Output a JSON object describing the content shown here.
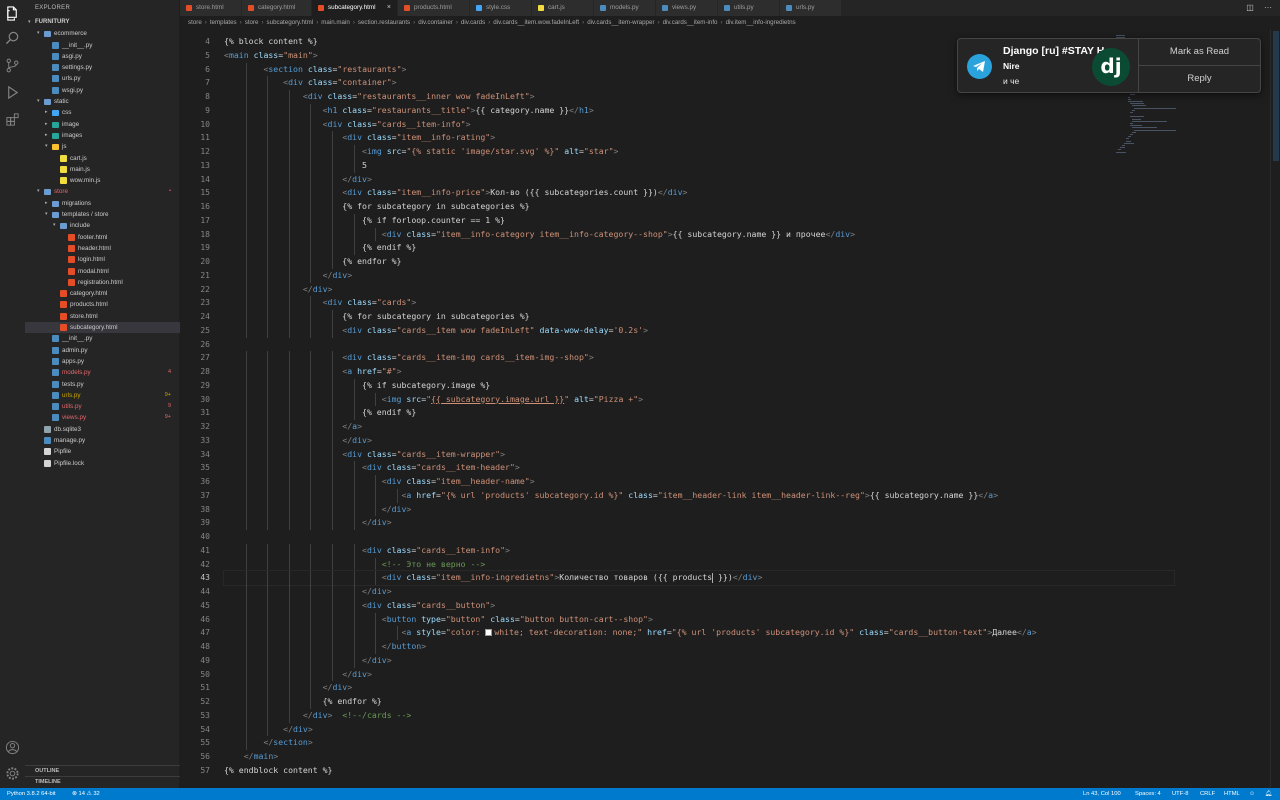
{
  "sidebar": {
    "title": "EXPLORER",
    "root": "FURNITURY",
    "items": [
      {
        "name": "ecommerce",
        "type": "folder",
        "depth": 1,
        "open": true,
        "color": "#6b9bd1"
      },
      {
        "name": "__init__.py",
        "type": "py",
        "depth": 2,
        "color": "#4b8bbe"
      },
      {
        "name": "asgi.py",
        "type": "py",
        "depth": 2,
        "color": "#4b8bbe"
      },
      {
        "name": "settings.py",
        "type": "py",
        "depth": 2,
        "color": "#4b8bbe"
      },
      {
        "name": "urls.py",
        "type": "py",
        "depth": 2,
        "color": "#4b8bbe"
      },
      {
        "name": "wsgi.py",
        "type": "py",
        "depth": 2,
        "color": "#4b8bbe"
      },
      {
        "name": "static",
        "type": "folder",
        "depth": 1,
        "open": true,
        "color": "#6b9bd1"
      },
      {
        "name": "css",
        "type": "folder",
        "depth": 2,
        "open": false,
        "color": "#42a5f5"
      },
      {
        "name": "image",
        "type": "folder",
        "depth": 2,
        "open": false,
        "color": "#26a69a"
      },
      {
        "name": "images",
        "type": "folder",
        "depth": 2,
        "open": false,
        "color": "#26a69a"
      },
      {
        "name": "js",
        "type": "folder",
        "depth": 2,
        "open": true,
        "color": "#fbc02d"
      },
      {
        "name": "cart.js",
        "type": "js",
        "depth": 3,
        "color": "#f1dd3f"
      },
      {
        "name": "main.js",
        "type": "js",
        "depth": 3,
        "color": "#f1dd3f"
      },
      {
        "name": "wow.min.js",
        "type": "js",
        "depth": 3,
        "color": "#f1dd3f"
      },
      {
        "name": "store",
        "type": "folder",
        "depth": 1,
        "open": true,
        "color": "#6b9bd1",
        "modified": true,
        "badge": "•"
      },
      {
        "name": "migrations",
        "type": "folder",
        "depth": 2,
        "open": false,
        "color": "#6b9bd1"
      },
      {
        "name": "templates / store",
        "type": "folder",
        "depth": 2,
        "open": true,
        "color": "#6b9bd1"
      },
      {
        "name": "include",
        "type": "folder",
        "depth": 3,
        "open": true,
        "color": "#6b9bd1"
      },
      {
        "name": "footer.html",
        "type": "html",
        "depth": 4,
        "color": "#e44d26"
      },
      {
        "name": "header.html",
        "type": "html",
        "depth": 4,
        "color": "#e44d26"
      },
      {
        "name": "login.html",
        "type": "html",
        "depth": 4,
        "color": "#e44d26"
      },
      {
        "name": "modal.html",
        "type": "html",
        "depth": 4,
        "color": "#e44d26"
      },
      {
        "name": "registration.html",
        "type": "html",
        "depth": 4,
        "color": "#e44d26"
      },
      {
        "name": "category.html",
        "type": "html",
        "depth": 3,
        "color": "#e44d26"
      },
      {
        "name": "products.html",
        "type": "html",
        "depth": 3,
        "color": "#e44d26"
      },
      {
        "name": "store.html",
        "type": "html",
        "depth": 3,
        "color": "#e44d26"
      },
      {
        "name": "subcategory.html",
        "type": "html",
        "depth": 3,
        "color": "#e44d26",
        "active": true
      },
      {
        "name": "__init__.py",
        "type": "py",
        "depth": 2,
        "color": "#4b8bbe"
      },
      {
        "name": "admin.py",
        "type": "py",
        "depth": 2,
        "color": "#4b8bbe"
      },
      {
        "name": "apps.py",
        "type": "py",
        "depth": 2,
        "color": "#4b8bbe"
      },
      {
        "name": "models.py",
        "type": "py",
        "depth": 2,
        "color": "#4b8bbe",
        "modified": true,
        "badge": "4"
      },
      {
        "name": "tests.py",
        "type": "py",
        "depth": 2,
        "color": "#4b8bbe"
      },
      {
        "name": "urls.py",
        "type": "py",
        "depth": 2,
        "color": "#4b8bbe",
        "warn": true,
        "badge": "9+"
      },
      {
        "name": "utils.py",
        "type": "py",
        "depth": 2,
        "color": "#4b8bbe",
        "modified": true,
        "badge": "9"
      },
      {
        "name": "views.py",
        "type": "py",
        "depth": 2,
        "color": "#4b8bbe",
        "modified": true,
        "badge": "9+"
      },
      {
        "name": "db.sqlite3",
        "type": "db",
        "depth": 1,
        "color": "#90a4ae"
      },
      {
        "name": "manage.py",
        "type": "py",
        "depth": 1,
        "color": "#4b8bbe"
      },
      {
        "name": "Pipfile",
        "type": "file",
        "depth": 1,
        "color": "#d4d4d4"
      },
      {
        "name": "Pipfile.lock",
        "type": "file",
        "depth": 1,
        "color": "#d4d4d4"
      }
    ],
    "outline": "OUTLINE",
    "timeline": "TIMELINE"
  },
  "tabs": [
    {
      "label": "store.html",
      "color": "#e44d26"
    },
    {
      "label": "category.html",
      "color": "#e44d26"
    },
    {
      "label": "subcategory.html",
      "color": "#e44d26",
      "active": true
    },
    {
      "label": "products.html",
      "color": "#e44d26"
    },
    {
      "label": "style.css",
      "color": "#42a5f5"
    },
    {
      "label": "cart.js",
      "color": "#f1dd3f"
    },
    {
      "label": "models.py",
      "color": "#4b8bbe"
    },
    {
      "label": "views.py",
      "color": "#4b8bbe"
    },
    {
      "label": "utils.py",
      "color": "#4b8bbe"
    },
    {
      "label": "urls.py",
      "color": "#4b8bbe"
    }
  ],
  "breadcrumb": [
    "store",
    "templates",
    "store",
    "subcategory.html",
    "main.main",
    "section.restaurants",
    "div.container",
    "div.cards",
    "div.cards__item.wow.fadeInLeft",
    "div.cards__item-wrapper",
    "div.cards__item-info",
    "div.item__info-ingredietns"
  ],
  "editor": {
    "first_line": 4,
    "current_line": 43,
    "lines": [
      "{% block content %}",
      "<main class=\"main\">",
      "        <section class=\"restaurants\">",
      "            <div class=\"container\">",
      "                <div class=\"restaurants__inner wow fadeInLeft\">",
      "                    <h1 class=\"restaurants__title\">{{ category.name }}</h1>",
      "                    <div class=\"cards__item-info\">",
      "                        <div class=\"item__info-rating\">",
      "                            <img src=\"{% static 'image/star.svg' %}\" alt=\"star\">",
      "                            5",
      "                        </div>",
      "                        <div class=\"item__info-price\">Кол-во ({{ subcategories.count }})</div>",
      "                        {% for subcategory in subcategories %}",
      "                            {% if forloop.counter == 1 %}",
      "                                <div class=\"item__info-category item__info-category--shop\">{{ subcategory.name }} и прочее</div>",
      "                            {% endif %}",
      "                        {% endfor %}",
      "                    </div>",
      "                </div>",
      "                    <div class=\"cards\">",
      "                        {% for subcategory in subcategories %}",
      "                        <div class=\"cards__item wow fadeInLeft\" data-wow-delay='0.2s'>",
      "",
      "                        <div class=\"cards__item-img cards__item-img--shop\">",
      "                        <a href=\"#\">",
      "                            {% if subcategory.image %}",
      "                                <img src=\"{{ subcategory.image.url }}\" alt=\"Pizza +\">",
      "                            {% endif %}",
      "                        </a>",
      "                        </div>",
      "                        <div class=\"cards__item-wrapper\">",
      "                            <div class=\"cards__item-header\">",
      "                                <div class=\"item__header-name\">",
      "                                    <a href=\"{% url 'products' subcategory.id %}\" class=\"item__header-link item__header-link--reg\">{{ subcategory.name }}</a>",
      "                                </div>",
      "                            </div>",
      "",
      "                            <div class=\"cards__item-info\">",
      "                                <!-- Это не верно -->",
      "                                <div class=\"item__info-ingredietns\">Количество товаров ({{ products }})</div>",
      "                            </div>",
      "                            <div class=\"cards__button\">",
      "                                <button type=\"button\" class=\"button button-cart--shop\">",
      "                                    <a style=\"color: white; text-decoration: none;\" href=\"{% url 'products' subcategory.id %}\" class=\"cards__button-text\">Далее</a>",
      "                                </button>",
      "                            </div>",
      "                        </div>",
      "                    </div>",
      "                    {% endfor %}",
      "                </div>  <!--/cards -->",
      "            </div>",
      "        </section>",
      "    </main>",
      "{% endblock content %}"
    ]
  },
  "notification": {
    "title": "Django [ru] #STAY H...",
    "sender": "Nire",
    "message": "и че",
    "avatar_text": "dj",
    "actions": [
      "Mark as Read",
      "Reply"
    ]
  },
  "statusbar": {
    "python": "Python 3.8.2 64-bit",
    "problems": "⊗ 14 ⚠ 32",
    "position": "Ln 43, Col 100",
    "spaces": "Spaces: 4",
    "encoding": "UTF-8",
    "eol": "CRLF",
    "language": "HTML"
  },
  "colors": {
    "statusbar": "#007acc",
    "tag": "#569cd6",
    "attr": "#9cdcfe",
    "string": "#ce9178",
    "comment": "#6a9955",
    "modified": "#e4676b",
    "warning": "#cca700",
    "telegram": "#2aa2dc",
    "django": "#0c4b33"
  }
}
